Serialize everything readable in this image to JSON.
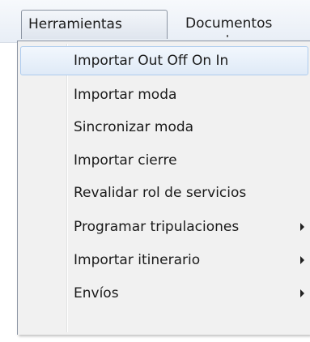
{
  "menubar": {
    "items": [
      {
        "label": "Herramientas",
        "open": true
      },
      {
        "label": "Documentos",
        "open": false
      }
    ]
  },
  "dropdown": {
    "items": [
      {
        "label": "Importar Out Off On In",
        "highlighted": true,
        "submenu": false
      },
      {
        "label": "Importar moda",
        "highlighted": false,
        "submenu": false
      },
      {
        "label": "Sincronizar moda",
        "highlighted": false,
        "submenu": false
      },
      {
        "label": "Importar cierre",
        "highlighted": false,
        "submenu": false
      },
      {
        "label": "Revalidar rol de servicios",
        "highlighted": false,
        "submenu": false
      },
      {
        "label": "Programar tripulaciones",
        "highlighted": false,
        "submenu": true
      },
      {
        "label": "Importar itinerario",
        "highlighted": false,
        "submenu": true
      },
      {
        "label": "Envíos",
        "highlighted": false,
        "submenu": true
      }
    ]
  },
  "colors": {
    "highlight_border": "#aeccee",
    "highlight_fill": "#dfeaf7",
    "menu_background": "#f1f1f1",
    "text": "#1a1a1a"
  },
  "icons": {
    "submenu_arrow": "chevron-right-icon"
  }
}
